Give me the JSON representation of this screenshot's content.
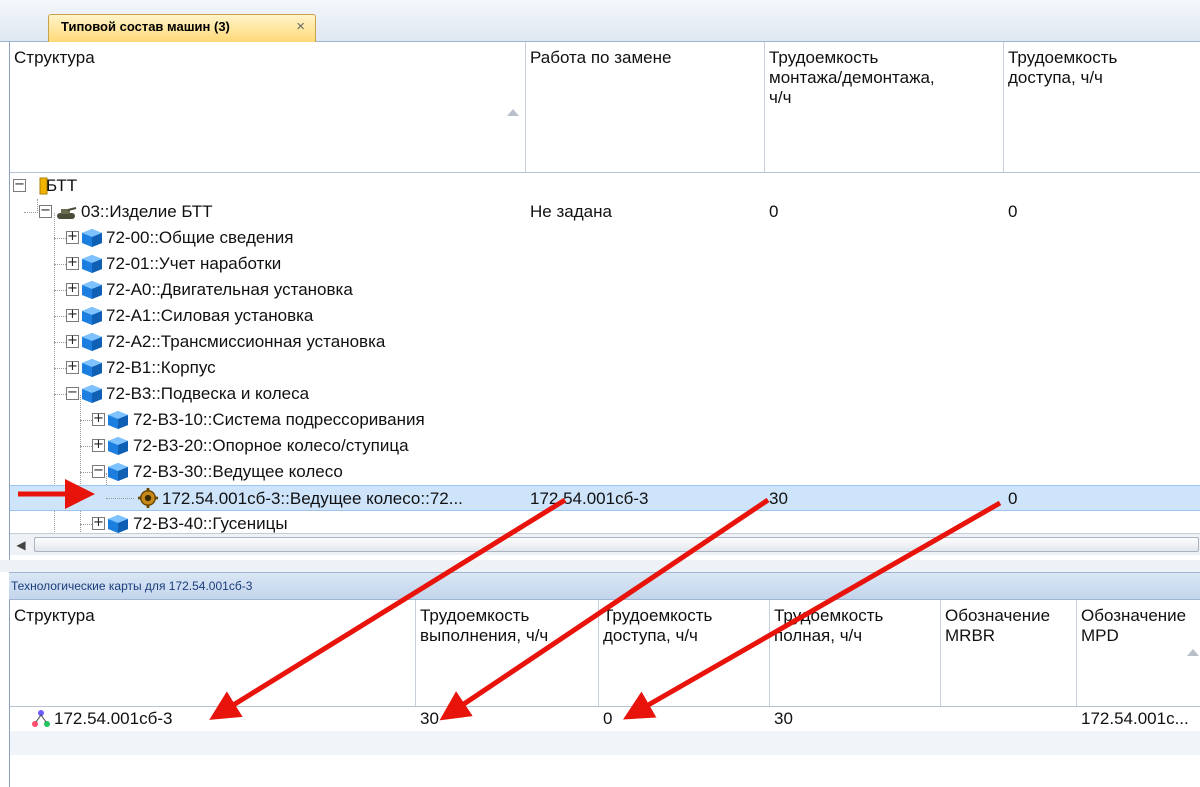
{
  "tab": {
    "title": "Типовой состав машин (3)",
    "close": "×"
  },
  "top_table": {
    "columns": [
      "Структура",
      "Работа по замене",
      "Трудоемкость\nмонтажа/демонтажа,\nч/ч",
      "Трудоемкость\nдоступа, ч/ч"
    ],
    "rows": [
      {
        "label": "БТТ",
        "replace": "",
        "mount": "",
        "access": ""
      },
      {
        "label": "03::Изделие БТТ",
        "replace": "Не задана",
        "mount": "0",
        "access": "0"
      },
      {
        "label": "72-00::Общие сведения",
        "replace": "",
        "mount": "",
        "access": ""
      },
      {
        "label": "72-01::Учет наработки",
        "replace": "",
        "mount": "",
        "access": ""
      },
      {
        "label": "72-A0::Двигательная установка",
        "replace": "",
        "mount": "",
        "access": ""
      },
      {
        "label": "72-A1::Силовая установка",
        "replace": "",
        "mount": "",
        "access": ""
      },
      {
        "label": "72-A2::Трансмиссионная установка",
        "replace": "",
        "mount": "",
        "access": ""
      },
      {
        "label": "72-B1::Корпус",
        "replace": "",
        "mount": "",
        "access": ""
      },
      {
        "label": "72-B3::Подвеска и колеса",
        "replace": "",
        "mount": "",
        "access": ""
      },
      {
        "label": "72-B3-10::Система подрессоривания",
        "replace": "",
        "mount": "",
        "access": ""
      },
      {
        "label": "72-B3-20::Опорное колесо/ступица",
        "replace": "",
        "mount": "",
        "access": ""
      },
      {
        "label": "72-B3-30::Ведущее колесо",
        "replace": "",
        "mount": "",
        "access": ""
      },
      {
        "label": "172.54.001сб-3::Ведущее колесо::72...",
        "replace": "172.54.001сб-3",
        "mount": "30",
        "access": "0"
      },
      {
        "label": "72-B3-40::Гусеницы",
        "replace": "",
        "mount": "",
        "access": ""
      }
    ]
  },
  "caption": "Технологические карты для 172.54.001сб-3",
  "bottom_table": {
    "columns": [
      "Структура",
      "Трудоемкость\nвыполнения, ч/ч",
      "Трудоемкость\nдоступа, ч/ч",
      "Трудоемкость\nполная, ч/ч",
      "Обозначение\nMRBR",
      "Обозначение\nMPD"
    ],
    "rows": [
      {
        "label": "172.54.001сб-3",
        "exec": "30",
        "access": "0",
        "full": "30",
        "mrbr": "",
        "mpd": "172.54.001с..."
      }
    ]
  },
  "colors": {
    "selection": "#cde4fb",
    "arrow": "#e8140c",
    "folder": "#f0b400"
  },
  "icons": [
    "folder-icon",
    "tank-icon",
    "cube-icon",
    "gear-icon",
    "techcard-icon",
    "expander-plus-icon",
    "expander-minus-icon",
    "sort-ascending-icon",
    "arrow-annotation"
  ]
}
